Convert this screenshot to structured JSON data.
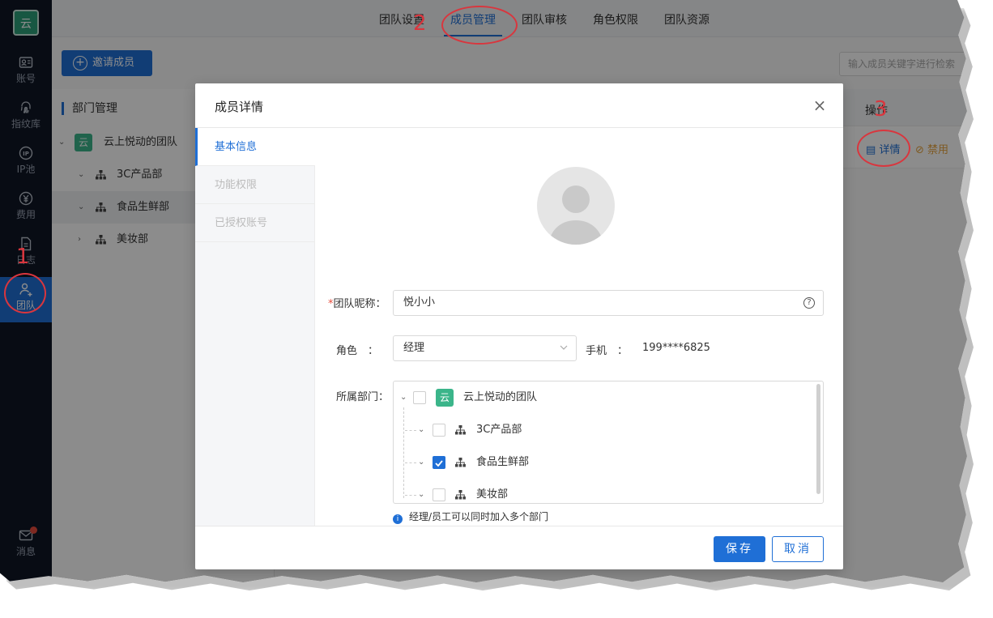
{
  "app": {
    "logo_text": "云"
  },
  "sidebar": {
    "items": [
      {
        "label": "账号",
        "icon": "id-card-icon"
      },
      {
        "label": "指纹库",
        "icon": "fingerprint-icon"
      },
      {
        "label": "IP池",
        "icon": "ip-icon"
      },
      {
        "label": "费用",
        "icon": "yen-icon"
      },
      {
        "label": "日志",
        "icon": "document-icon"
      },
      {
        "label": "团队",
        "icon": "team-icon",
        "active": true
      }
    ],
    "message_label": "消息"
  },
  "tabs": [
    {
      "label": "团队设置"
    },
    {
      "label": "成员管理",
      "active": true
    },
    {
      "label": "团队审核"
    },
    {
      "label": "角色权限"
    },
    {
      "label": "团队资源"
    }
  ],
  "toolbar": {
    "invite_label": "邀请成员",
    "search_placeholder": "输入成员关键字进行检索"
  },
  "dept_panel": {
    "title": "部门管理",
    "root": "云上悦动的团队",
    "root_badge": "云",
    "children": [
      "3C产品部",
      "食品生鲜部",
      "美妆部"
    ],
    "selected": "食品生鲜部"
  },
  "table": {
    "op_header": "操作",
    "detail_label": "详情",
    "disable_label": "禁用"
  },
  "modal": {
    "title": "成员详情",
    "close_glyph": "×",
    "nav": [
      {
        "label": "基本信息",
        "active": true
      },
      {
        "label": "功能权限"
      },
      {
        "label": "已授权账号"
      }
    ],
    "form": {
      "nickname_required_mark": "*",
      "nickname_label": "团队昵称：",
      "nickname_value": "悦小小",
      "role_label": "角色　：",
      "role_value": "经理",
      "phone_label": "手机　：",
      "phone_value": "199****6825",
      "dept_label": "所属部门：",
      "dept_tree": {
        "root": "云上悦动的团队",
        "root_badge": "云",
        "children": [
          {
            "label": "3C产品部",
            "checked": false
          },
          {
            "label": "食品生鲜部",
            "checked": true
          },
          {
            "label": "美妆部",
            "checked": false
          }
        ]
      },
      "hint": "经理/员工可以同时加入多个部门",
      "hint_icon": "i"
    },
    "save_label": "保存",
    "cancel_label": "取消"
  },
  "annotations": {
    "step1": "1",
    "step2": "2",
    "step3": "3"
  },
  "colors": {
    "primary": "#1f6fd6",
    "sidebar_bg": "#0f1726",
    "annotation": "#d9363e",
    "warning": "#e6a23c"
  }
}
